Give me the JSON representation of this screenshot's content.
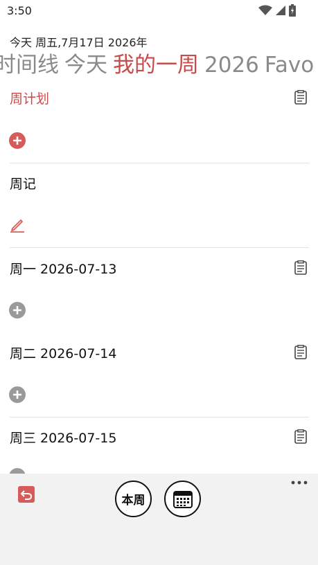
{
  "status": {
    "time": "3:50"
  },
  "header": {
    "date_line": "今天  周五,7月17日 2026年",
    "tabs": [
      "时间线",
      "今天",
      "我的一周",
      "2026",
      "Favo"
    ],
    "active_tab": 2
  },
  "sections": {
    "weekly_plan": {
      "title": "周计划"
    },
    "weekly_journal": {
      "title": "周记"
    },
    "monday": {
      "title": "周一 2026-07-13"
    },
    "tuesday": {
      "title": "周二 2026-07-14"
    },
    "wednesday": {
      "title": "周三 2026-07-15"
    }
  },
  "bottom": {
    "this_week_label": "本周"
  },
  "colors": {
    "accent": "#c94a4a",
    "grey_icon": "#9a9a9a"
  }
}
